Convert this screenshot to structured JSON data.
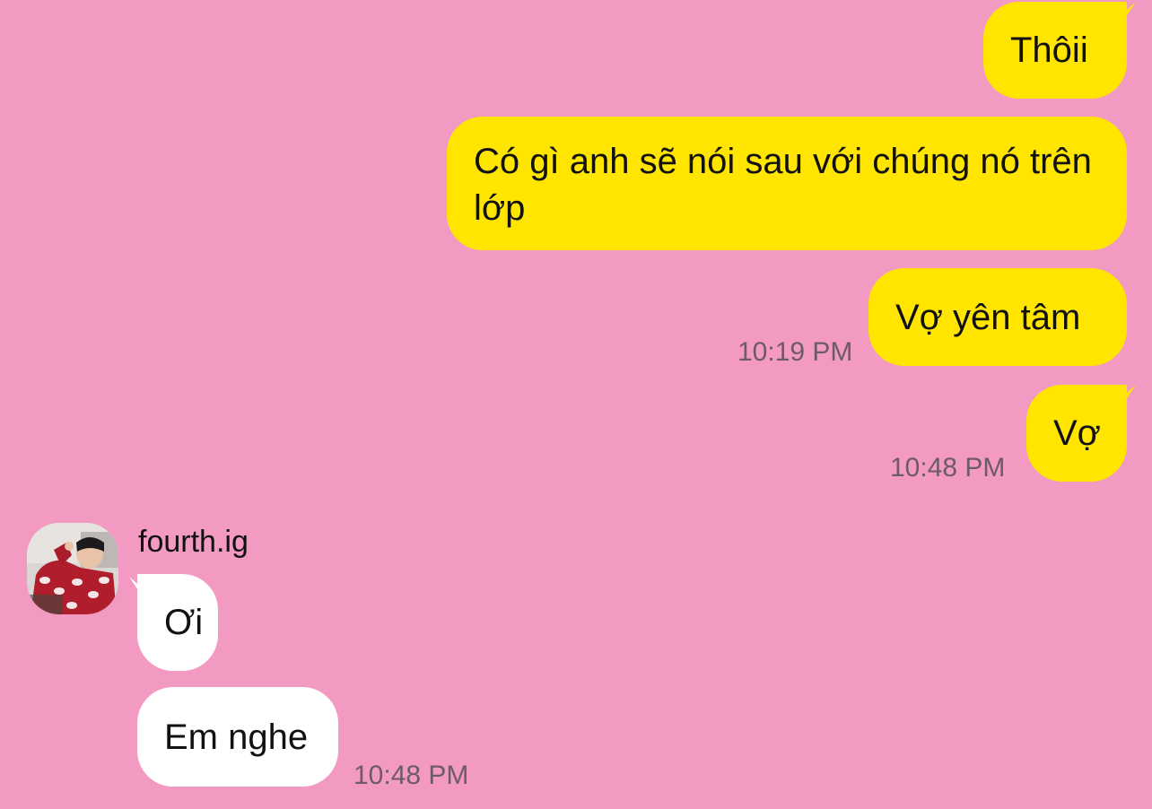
{
  "messages": {
    "out_1": "Thôii",
    "out_2": "Có gì anh sẽ nói sau với chúng nó trên lớp",
    "out_3": "Vợ yên tâm",
    "out_4": "Vợ",
    "in_1": "Ơi",
    "in_2": "Em nghe"
  },
  "timestamps": {
    "t1": "10:19 PM",
    "t2": "10:48 PM",
    "t3": "10:48 PM"
  },
  "sender": {
    "name": "fourth.ig"
  },
  "colors": {
    "background": "#f39ac2",
    "outgoing_bubble": "#ffe500",
    "incoming_bubble": "#ffffff",
    "timestamp": "#6e5b66"
  }
}
